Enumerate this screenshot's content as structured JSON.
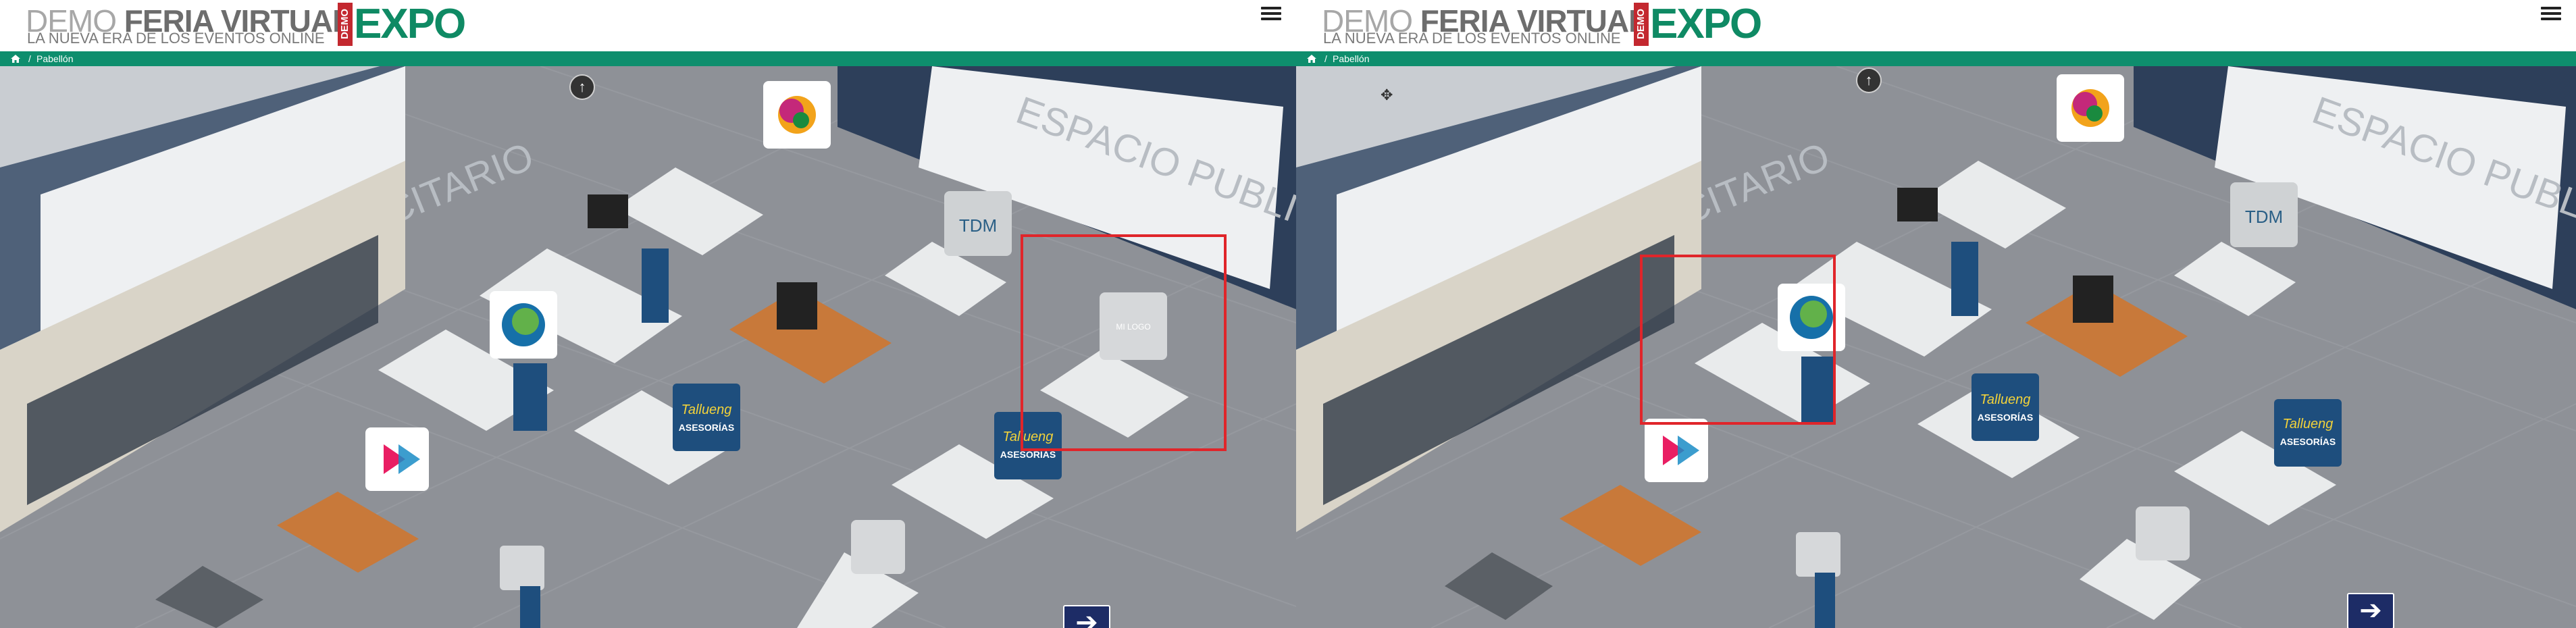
{
  "header": {
    "brand_prefix": "DEMO",
    "brand_name": "FERIA VIRTUAL",
    "tagline": "LA NUEVA ERA DE LOS EVENTOS ONLINE",
    "logo_badge": "DEMO",
    "logo_word": "EXPO",
    "menu_icon": "hamburger-icon"
  },
  "breadcrumb": {
    "home_icon": "home-icon",
    "separator": "/",
    "current": "Pabellón"
  },
  "scene": {
    "billboard_text": "ESPACIO PUBLICITARIO",
    "stand_tdm_logo": "TDM",
    "stand_tallueng_logo": "Tallueng",
    "stand_tallueng_sub": "ASESORÍAS",
    "stand_placeholder_text": "MI LOGO"
  },
  "colors": {
    "brand_green": "#0e8e6d",
    "logo_red": "#c3282f",
    "highlight_red": "#e0252a",
    "nav_blue": "#1d2c66"
  }
}
